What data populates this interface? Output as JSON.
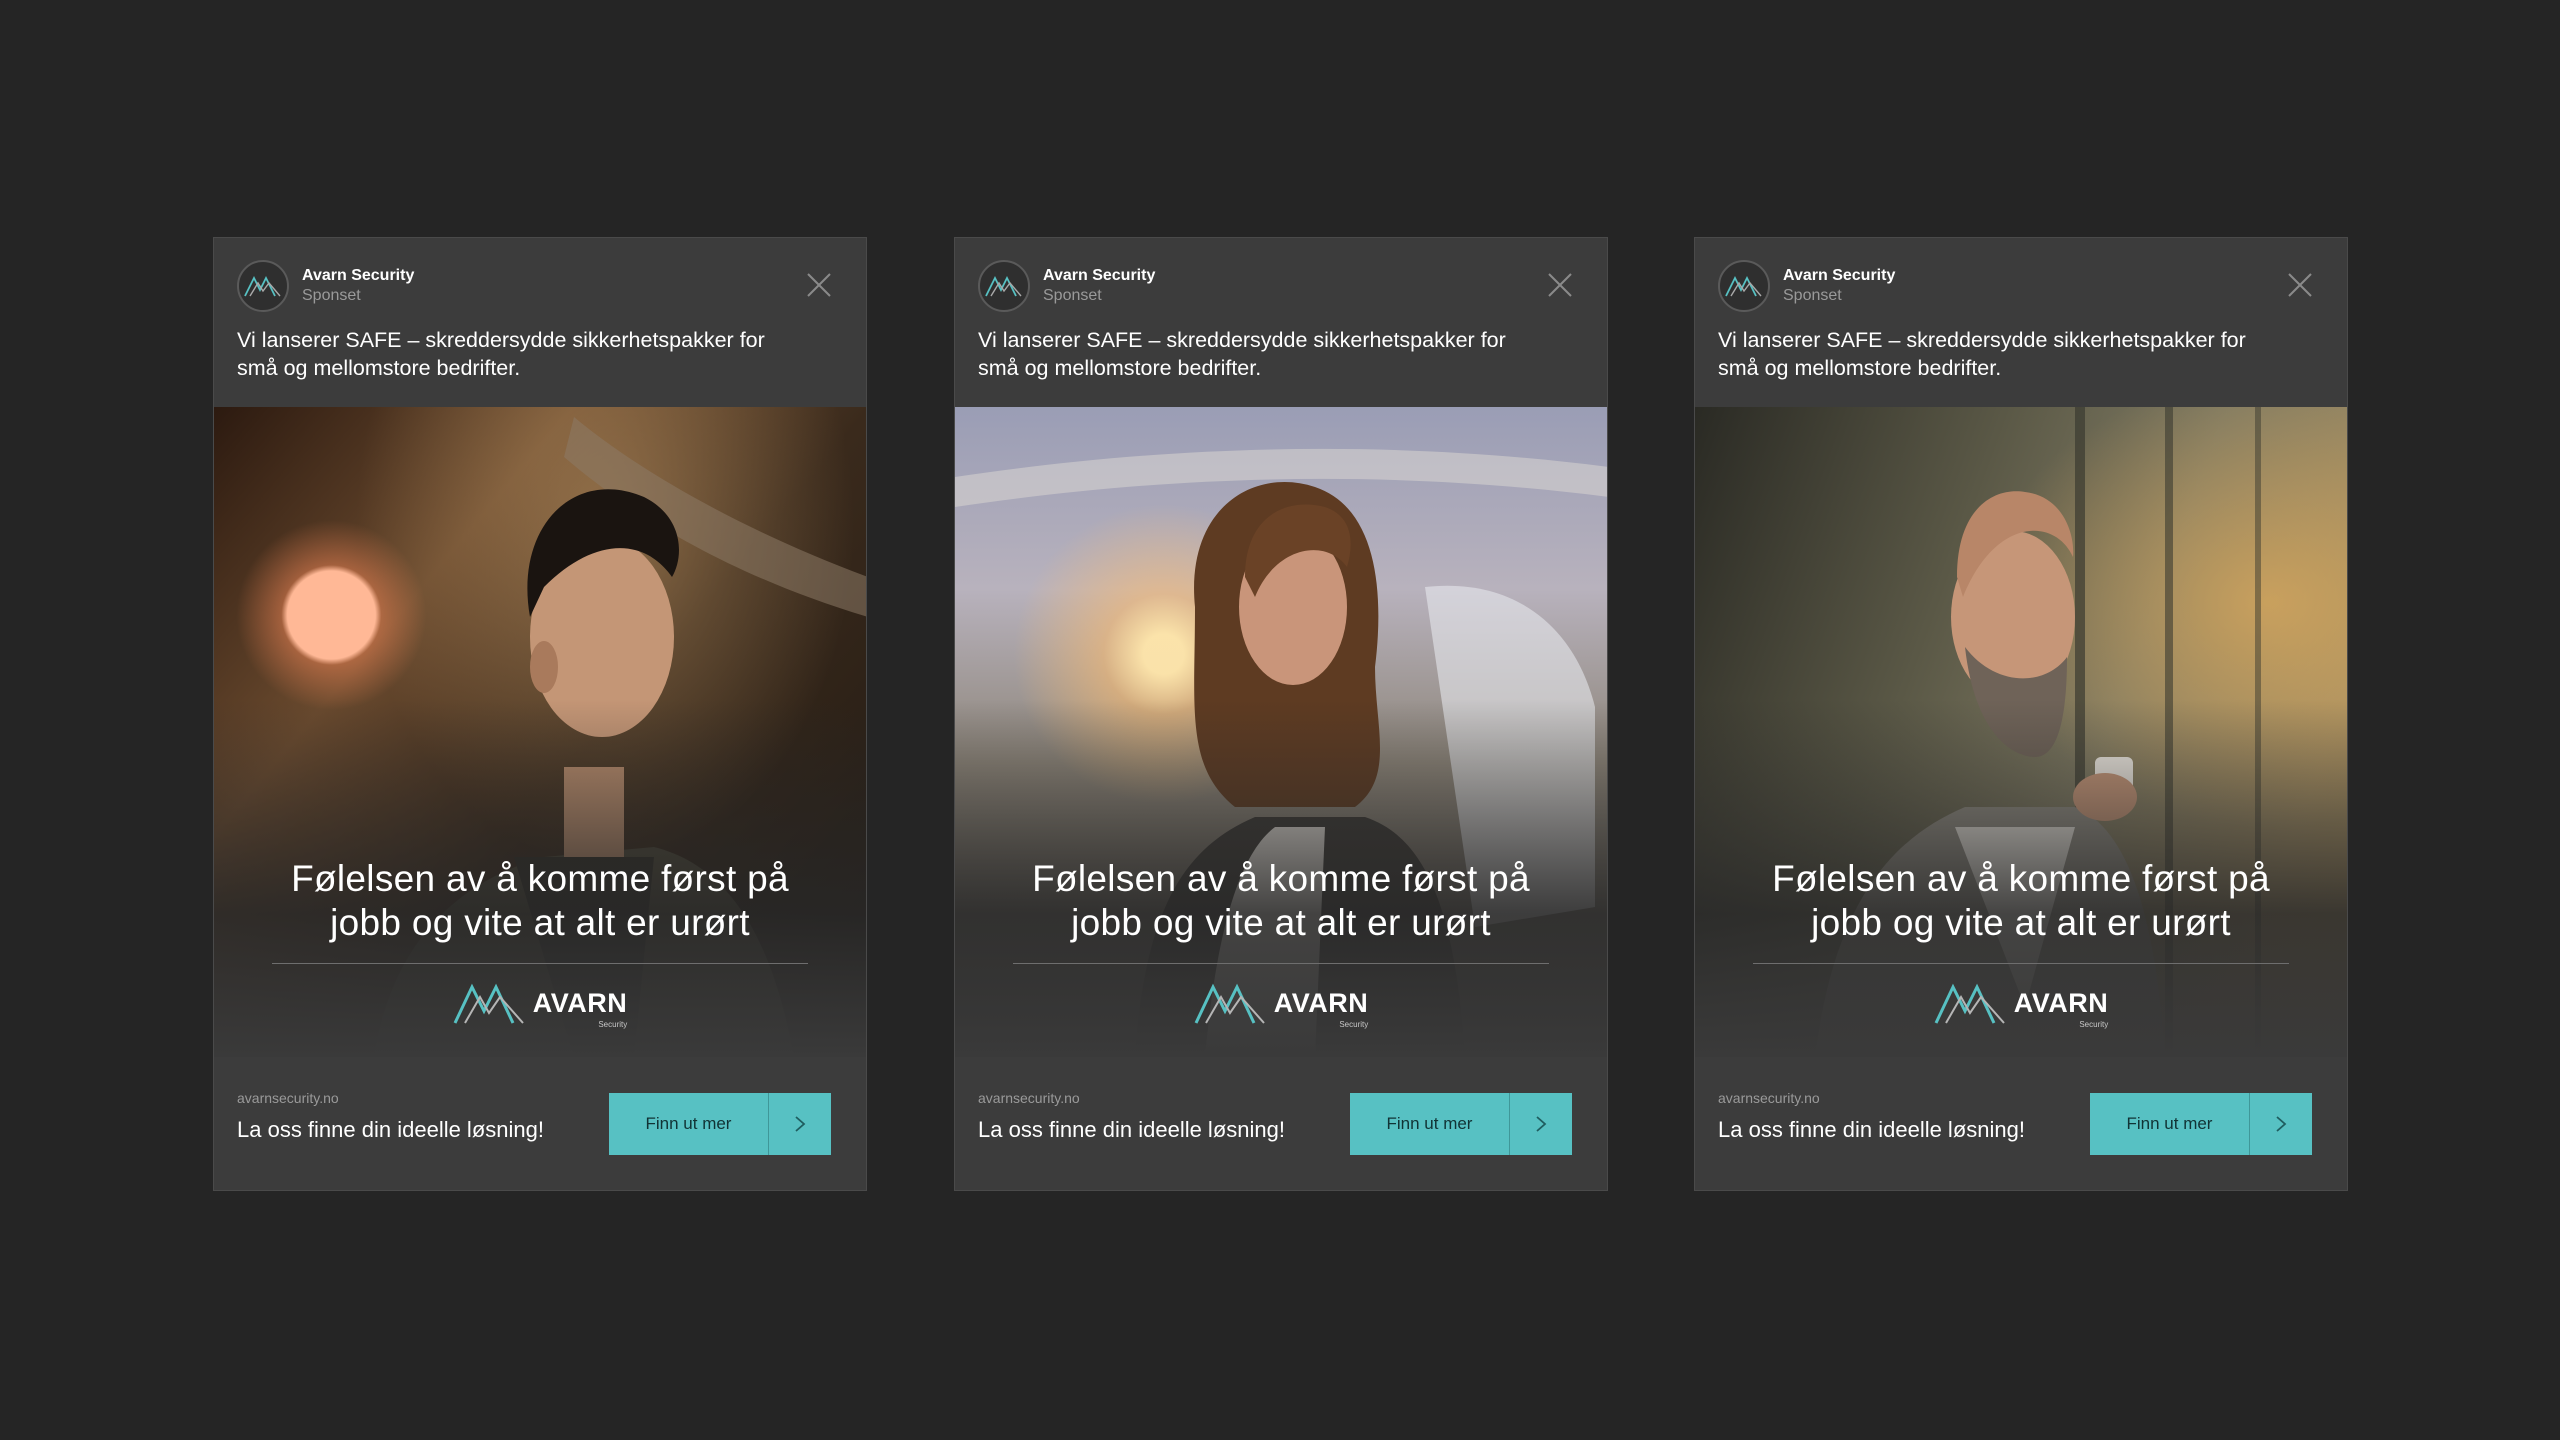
{
  "colors": {
    "background": "#252525",
    "card": "#3c3c3c",
    "accent": "#57c1c3",
    "text": "#ffffff",
    "muted": "#9a9a9a"
  },
  "icons": {
    "brand_logo": "avarn-mountain-logo-icon",
    "close": "close-icon",
    "arrow": "chevron-right-icon"
  },
  "ads": [
    {
      "advertiser": "Avarn Security",
      "sponsored": "Sponset",
      "text": "Vi lanserer SAFE – skreddersydde sikkerhetspakker for små og mellomstore bedrifter.",
      "headline_1": "Følelsen av å komme først på",
      "headline_2": "jobb og vite at alt er urørt",
      "logo_name": "AVARN",
      "logo_sub": "Security",
      "domain": "avarnsecurity.no",
      "cta_text": "La oss finne din ideelle løsning!",
      "button": "Finn ut mer"
    },
    {
      "advertiser": "Avarn Security",
      "sponsored": "Sponset",
      "text": "Vi lanserer SAFE – skreddersydde sikkerhetspakker for små og mellomstore bedrifter.",
      "headline_1": "Følelsen av å komme først på",
      "headline_2": "jobb og vite at alt er urørt",
      "logo_name": "AVARN",
      "logo_sub": "Security",
      "domain": "avarnsecurity.no",
      "cta_text": "La oss finne din ideelle løsning!",
      "button": "Finn ut mer"
    },
    {
      "advertiser": "Avarn Security",
      "sponsored": "Sponset",
      "text": "Vi lanserer SAFE – skreddersydde sikkerhetspakker for små og mellomstore bedrifter.",
      "headline_1": "Følelsen av å komme først på",
      "headline_2": "jobb og vite at alt er urørt",
      "logo_name": "AVARN",
      "logo_sub": "Security",
      "domain": "avarnsecurity.no",
      "cta_text": "La oss finne din ideelle løsning!",
      "button": "Finn ut mer"
    }
  ]
}
